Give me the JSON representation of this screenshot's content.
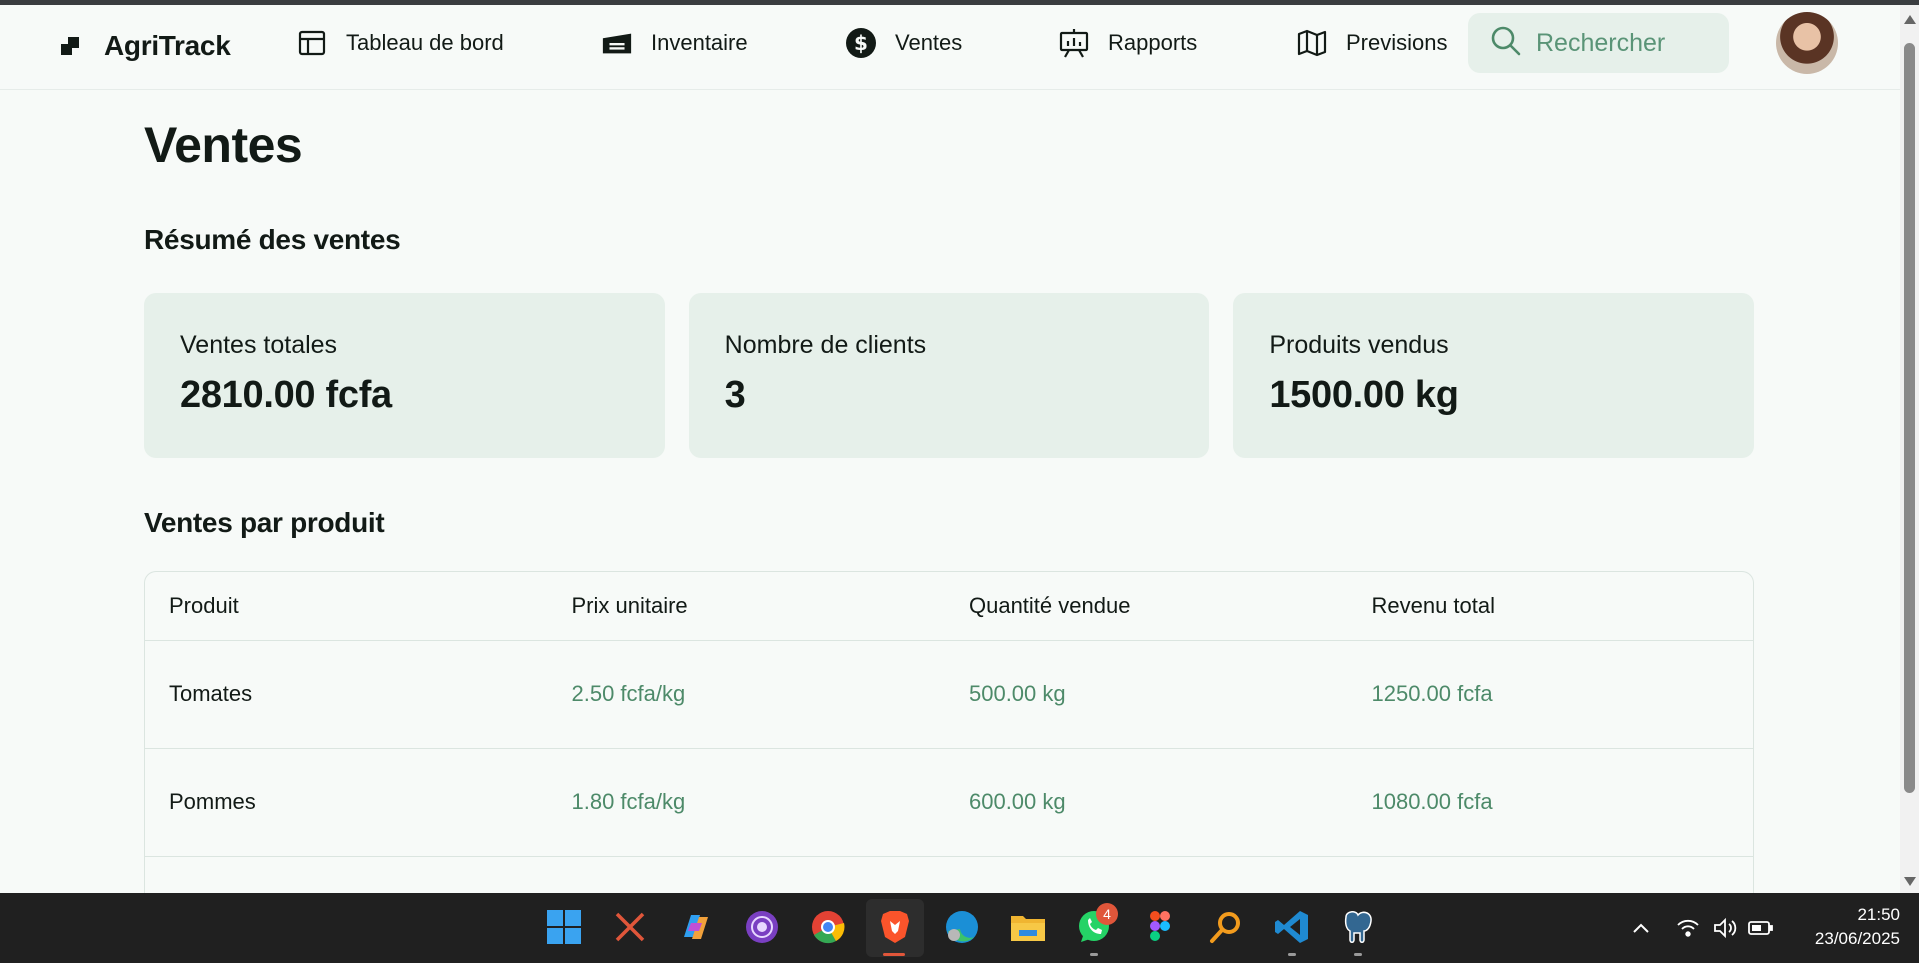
{
  "app": {
    "name": "AgriTrack"
  },
  "nav": {
    "items": [
      {
        "label": "Tableau de bord",
        "icon": "layout-icon"
      },
      {
        "label": "Inventaire",
        "icon": "warehouse-icon"
      },
      {
        "label": "Ventes",
        "icon": "currency-dollar-icon"
      },
      {
        "label": "Rapports",
        "icon": "presentation-chart-icon"
      },
      {
        "label": "Previsions",
        "icon": "map-icon"
      }
    ]
  },
  "search": {
    "placeholder": "Rechercher"
  },
  "page": {
    "title": "Ventes"
  },
  "summary": {
    "title": "Résumé des ventes",
    "cards": [
      {
        "label": "Ventes totales",
        "value": "2810.00 fcfa"
      },
      {
        "label": "Nombre de clients",
        "value": "3"
      },
      {
        "label": "Produits vendus",
        "value": "1500.00 kg"
      }
    ]
  },
  "by_product": {
    "title": "Ventes par produit",
    "columns": [
      "Produit",
      "Prix unitaire",
      "Quantité vendue",
      "Revenu total"
    ],
    "rows": [
      {
        "product": "Tomates",
        "unit_price": "2.50 fcfa/kg",
        "quantity": "500.00 kg",
        "revenue": "1250.00 fcfa"
      },
      {
        "product": "Pommes",
        "unit_price": "1.80 fcfa/kg",
        "quantity": "600.00 kg",
        "revenue": "1080.00 fcfa"
      }
    ]
  },
  "taskbar": {
    "whatsapp_badge": "4",
    "time": "21:50",
    "date": "23/06/2025"
  },
  "colors": {
    "accent_green": "#4d8a69",
    "card_bg": "#e6f0ea",
    "page_bg": "#f7faf8",
    "text": "#121a16"
  }
}
